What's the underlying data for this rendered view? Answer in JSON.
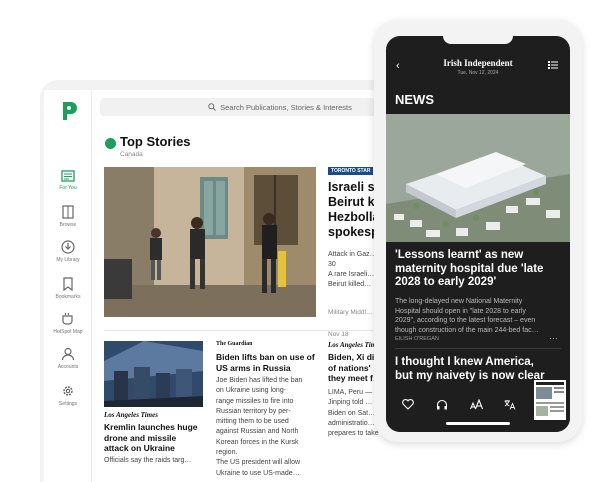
{
  "tablet": {
    "search_placeholder": "Search Publications, Stories & Interests",
    "nav": [
      {
        "label": "For You",
        "icon": "newspaper-icon"
      },
      {
        "label": "Browse",
        "icon": "book-icon"
      },
      {
        "label": "My Library",
        "icon": "download-icon"
      },
      {
        "label": "Bookmarks",
        "icon": "bookmark-icon"
      },
      {
        "label": "HotSpot Map",
        "icon": "cup-icon"
      },
      {
        "label": "Accounts",
        "icon": "person-icon"
      },
      {
        "label": "Settings",
        "icon": "gear-icon"
      }
    ],
    "top_stories": {
      "title": "Top Stories",
      "region": "Canada"
    },
    "hero": {
      "publication": "TORONTO STAR",
      "headline": "Israeli st…\nBeirut kil…\nHezbolla…\nspokesp…",
      "body": "Attack in Gaz…\n30\nA rare Israeli…\nBeirut killed…",
      "tags": "Military   Middl…",
      "date": "Nov 18"
    },
    "cards": [
      {
        "masthead": "Los Angeles Times",
        "title": "Kremlin launches huge\ndrone and missile\nattack on Ukraine",
        "body": "Officials say the raids targ…"
      },
      {
        "masthead": "The Guardian",
        "title": "Biden lifts ban on use of\nUS arms in Russia",
        "body": "Joe Biden has lifted the ban\non Ukraine using long-\nrange missiles to fire into\nRussian territory by per-\nmitting them to be used\nagainst Russian and North\nKorean forces in the Kursk\nregion.\nThe US president will allow\nUkraine to use US-made…"
      },
      {
        "masthead": "Los Angeles Times",
        "title": "Biden, Xi dis…\nof nations' …\nthey meet f…",
        "body": "LIMA, Peru —\nJinping told …\nBiden on Sat…\nadministratio…\nprepares to take over…"
      }
    ]
  },
  "phone": {
    "brand": "Irish Independent",
    "date": "Tue, Nov 12, 2024",
    "section": "NEWS",
    "headline": "'Lessons learnt' as new\nmaternity hospital due 'late\n2028 to early 2029'",
    "body": "The long-delayed new National Maternity\nHospital should open in \"late 2028 to early\n2029\", according to the latest forecast – even\nthough construction of the main 244-bed fac…",
    "author": "EILISH O'REGAN",
    "headline2": "I thought I knew America,\nbut my naivety is now clear"
  }
}
